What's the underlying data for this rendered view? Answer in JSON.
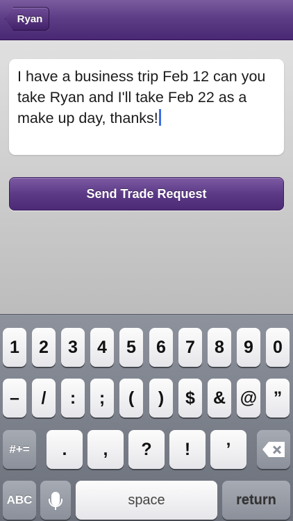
{
  "navbar": {
    "back_label": "Ryan"
  },
  "message": {
    "text": "I have a business trip Feb 12 can you take Ryan and I'll take Feb 22 as a make up day, thanks!"
  },
  "send_button": {
    "label": "Send Trade Request"
  },
  "keyboard": {
    "row1": [
      "1",
      "2",
      "3",
      "4",
      "5",
      "6",
      "7",
      "8",
      "9",
      "0"
    ],
    "row2": [
      "–",
      "/",
      ":",
      ";",
      "(",
      ")",
      "$",
      "&",
      "@",
      "”"
    ],
    "row3": [
      ".",
      ",",
      "?",
      "!",
      "’"
    ],
    "symbols_label": "#+=",
    "abc_label": "ABC",
    "space_label": "space",
    "return_label": "return"
  },
  "colors": {
    "brand_purple": "#5c3a86",
    "caret_blue": "#3b6fe0"
  }
}
